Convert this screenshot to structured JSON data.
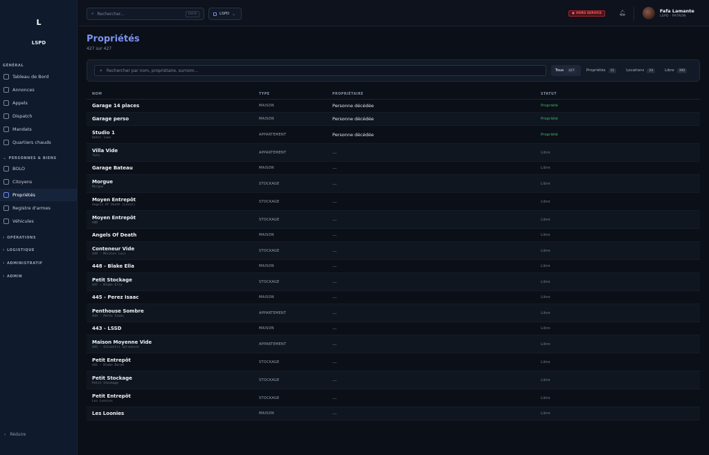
{
  "sidebar": {
    "logo": "L",
    "brand": "LSPD",
    "sections": {
      "general": "GÉNÉRAL",
      "personnes": "PERSONNES & BIENS",
      "operations": "OPÉRATIONS",
      "logistique": "LOGISTIQUE",
      "administratif": "ADMINISTRATIF",
      "admin": "ADMIN"
    },
    "general_items": [
      "Tableau de Bord",
      "Annonces",
      "Appels",
      "Dispatch",
      "Mandats",
      "Quartiers chauds"
    ],
    "personnes_items": [
      "BOLO",
      "Citoyens",
      "Propriétés",
      "Registre d'armes",
      "Véhicules"
    ],
    "active_item": "Propriétés",
    "collapse_label": "Réduire"
  },
  "topbar": {
    "search_placeholder": "Rechercher...",
    "search_shortcut": "Ctrl K",
    "org": "LSPD",
    "status_badge": "HORS SERVICE",
    "user_name": "Fafa Lamante",
    "user_role": "LSPD · PATRON"
  },
  "page": {
    "title": "Propriétés",
    "count": "427 sur 427",
    "filter_placeholder": "Rechercher par nom, propriétaire, surnom...",
    "tabs": [
      {
        "label": "Tous",
        "count": "427",
        "active": true
      },
      {
        "label": "Propriétés",
        "count": "11",
        "active": false
      },
      {
        "label": "Locations",
        "count": "24",
        "active": false
      },
      {
        "label": "Libre",
        "count": "392",
        "active": false
      }
    ]
  },
  "table": {
    "columns": [
      "NOM",
      "TYPE",
      "PROPRIÉTAIRE",
      "STATUT"
    ],
    "status_colors": {
      "Propriété": "#3fb35f",
      "Libre": "#6b7486"
    },
    "rows": [
      {
        "name": "Garage 14 places",
        "sub": "",
        "type": "MAISON",
        "owner": "Personne décédée",
        "status": "Propriété"
      },
      {
        "name": "Garage perso",
        "sub": "",
        "type": "MAISON",
        "owner": "Personne décédée",
        "status": "Propriété"
      },
      {
        "name": "Studio 1",
        "sub": "Hotel luxe",
        "type": "APPARTEMENT",
        "owner": "Personne décédée",
        "status": "Propriété"
      },
      {
        "name": "Villa Vide",
        "sub": "fafa",
        "type": "APPARTEMENT",
        "owner": "—",
        "status": "Libre"
      },
      {
        "name": "Garage Bateau",
        "sub": "",
        "type": "MAISON",
        "owner": "—",
        "status": "Libre"
      },
      {
        "name": "Morgue",
        "sub": "Morgue",
        "type": "STOCKAGE",
        "owner": "—",
        "status": "Libre"
      },
      {
        "name": "Moyen Entrepôt",
        "sub": "Angels Of Death (Local)",
        "type": "STOCKAGE",
        "owner": "—",
        "status": "Libre"
      },
      {
        "name": "Moyen Entrepôt",
        "sub": "AOD",
        "type": "STOCKAGE",
        "owner": "—",
        "status": "Libre"
      },
      {
        "name": "Angels Of Death",
        "sub": "",
        "type": "MAISON",
        "owner": "—",
        "status": "Libre"
      },
      {
        "name": "Conteneur Vide",
        "sub": "449 - Morales Luis",
        "type": "STOCKAGE",
        "owner": "—",
        "status": "Libre"
      },
      {
        "name": "448 - Blake Ella",
        "sub": "",
        "type": "MAISON",
        "owner": "—",
        "status": "Libre"
      },
      {
        "name": "Petit Stockage",
        "sub": "447 - Blake Ella",
        "type": "STOCKAGE",
        "owner": "—",
        "status": "Libre"
      },
      {
        "name": "445 - Perez Isaac",
        "sub": "",
        "type": "MAISON",
        "owner": "—",
        "status": "Libre"
      },
      {
        "name": "Penthouse Sombre",
        "sub": "444 - Perez Isaac",
        "type": "APPARTEMENT",
        "owner": "—",
        "status": "Libre"
      },
      {
        "name": "443 - LSSD",
        "sub": "",
        "type": "MAISON",
        "owner": "—",
        "status": "Libre"
      },
      {
        "name": "Maison Moyenne Vide",
        "sub": "442 - Silvestri Salvatore",
        "type": "APPARTEMENT",
        "owner": "—",
        "status": "Libre"
      },
      {
        "name": "Petit Entrepôt",
        "sub": "441 - Blake Derek",
        "type": "STOCKAGE",
        "owner": "—",
        "status": "Libre"
      },
      {
        "name": "Petit Stockage",
        "sub": "Petit Stockage",
        "type": "STOCKAGE",
        "owner": "—",
        "status": "Libre"
      },
      {
        "name": "Petit Entrepôt",
        "sub": "Les Loonies",
        "type": "STOCKAGE",
        "owner": "—",
        "status": "Libre"
      },
      {
        "name": "Les Loonies",
        "sub": "",
        "type": "MAISON",
        "owner": "—",
        "status": "Libre"
      }
    ]
  }
}
